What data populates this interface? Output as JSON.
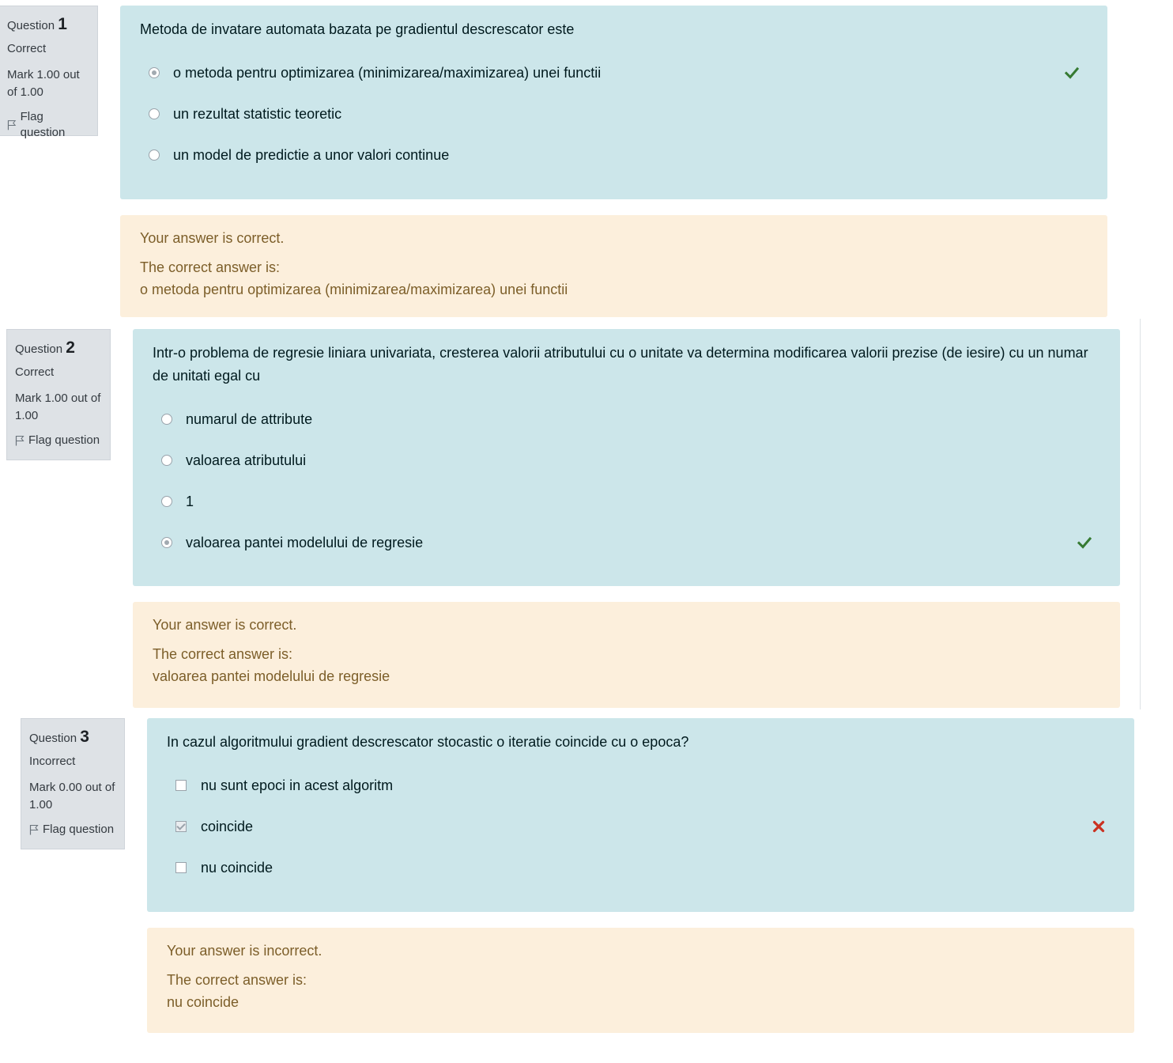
{
  "questions": [
    {
      "label": "Question",
      "number": "1",
      "state": "Correct",
      "mark": "Mark 1.00 out of 1.00",
      "flag": "Flag question",
      "text": "Metoda de invatare automata bazata pe gradientul descrescator este",
      "input_type": "radio",
      "answers": [
        {
          "text": "o metoda pentru optimizarea (minimizarea/maximizarea) unei functii",
          "checked": true,
          "result": "correct-icon"
        },
        {
          "text": "un rezultat statistic teoretic",
          "checked": false,
          "result": ""
        },
        {
          "text": "un model de predictie a unor valori continue",
          "checked": false,
          "result": ""
        }
      ],
      "feedback": {
        "status": "Your answer is correct.",
        "correct_label": "The correct answer is:",
        "correct_answer": "o metoda pentru optimizarea (minimizarea/maximizarea) unei functii"
      }
    },
    {
      "label": "Question",
      "number": "2",
      "state": "Correct",
      "mark": "Mark 1.00 out of 1.00",
      "flag": "Flag question",
      "text": "Intr-o problema de regresie liniara univariata, cresterea valorii atributului cu o unitate va determina modificarea valorii prezise (de iesire) cu un numar de unitati egal cu",
      "input_type": "radio",
      "answers": [
        {
          "text": "numarul de attribute",
          "checked": false,
          "result": ""
        },
        {
          "text": "valoarea atributului",
          "checked": false,
          "result": ""
        },
        {
          "text": "1",
          "checked": false,
          "result": ""
        },
        {
          "text": "valoarea pantei modelului de regresie",
          "checked": true,
          "result": "correct-icon"
        }
      ],
      "feedback": {
        "status": "Your answer is correct.",
        "correct_label": "The correct answer is:",
        "correct_answer": "valoarea pantei modelului de regresie"
      }
    },
    {
      "label": "Question",
      "number": "3",
      "state": "Incorrect",
      "mark": "Mark 0.00 out of 1.00",
      "flag": "Flag question",
      "text": "In cazul algoritmului gradient descrescator stocastic o iteratie coincide cu o epoca?",
      "input_type": "checkbox",
      "answers": [
        {
          "text": "nu sunt epoci in acest algoritm",
          "checked": false,
          "result": ""
        },
        {
          "text": "coincide",
          "checked": true,
          "result": "incorrect-icon"
        },
        {
          "text": "nu coincide",
          "checked": false,
          "result": ""
        }
      ],
      "feedback": {
        "status": "Your answer is incorrect.",
        "correct_label": "The correct answer is:",
        "correct_answer": "nu coincide"
      }
    }
  ],
  "colors": {
    "formulation_bg": "#cce6ea",
    "feedback_bg": "#fcefdc",
    "info_bg": "#dee2e6",
    "correct": "#357a32",
    "incorrect": "#ca3120"
  }
}
